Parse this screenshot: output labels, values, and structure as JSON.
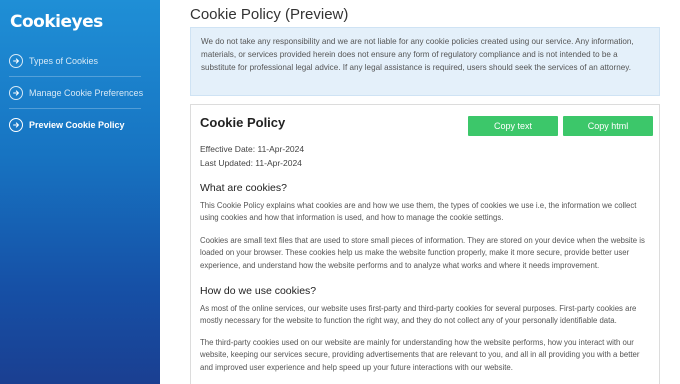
{
  "app": {
    "logo": "Cookieyes"
  },
  "sidebar": {
    "items": [
      {
        "label": "Types of Cookies",
        "active": false
      },
      {
        "label": "Manage Cookie Preferences",
        "active": false
      },
      {
        "label": "Preview Cookie Policy",
        "active": true
      }
    ]
  },
  "main": {
    "title": "Cookie Policy (Preview)",
    "notice": "We do not take any responsibility and we are not liable for any cookie policies created using our service. Any information, materials, or services provided herein does not ensure any form of regulatory compliance and is not intended to be a substitute for professional legal advice. If any legal assistance is required, users should seek the services of an attorney."
  },
  "policy": {
    "title": "Cookie Policy",
    "copy_text_label": "Copy text",
    "copy_html_label": "Copy html",
    "effective_date": "Effective Date: 11-Apr-2024",
    "last_updated": "Last Updated: 11-Apr-2024",
    "sections": [
      {
        "heading": "What are cookies?",
        "paragraphs": [
          "This Cookie Policy explains what cookies are and how we use them, the types of cookies we use i.e, the information we collect using cookies and how that information is used, and how to manage the cookie settings.",
          "Cookies are small text files that are used to store small pieces of information. They are stored on your device when the website is loaded on your browser. These cookies help us make the website function properly, make it more secure, provide better user experience, and understand how the website performs and to analyze what works and where it needs improvement."
        ]
      },
      {
        "heading": "How do we use cookies?",
        "paragraphs": [
          "As most of the online services, our website uses first-party and third-party cookies for several purposes. First-party cookies are mostly necessary for the website to function the right way, and they do not collect any of your personally identifiable data.",
          "The third-party cookies used on our website are mainly for understanding how the website performs, how you interact with our website, keeping our services secure, providing advertisements that are relevant to you, and all in all providing you with a better and improved user experience and help speed up your future interactions with our website."
        ]
      }
    ]
  },
  "colors": {
    "sidebar_top": "#1f8fd6",
    "sidebar_bottom": "#1a3f91",
    "button_green": "#3cc76a",
    "notice_bg": "#e4f0fa"
  },
  "icons": {
    "nav_arrow": "arrow-right-circle-icon"
  }
}
